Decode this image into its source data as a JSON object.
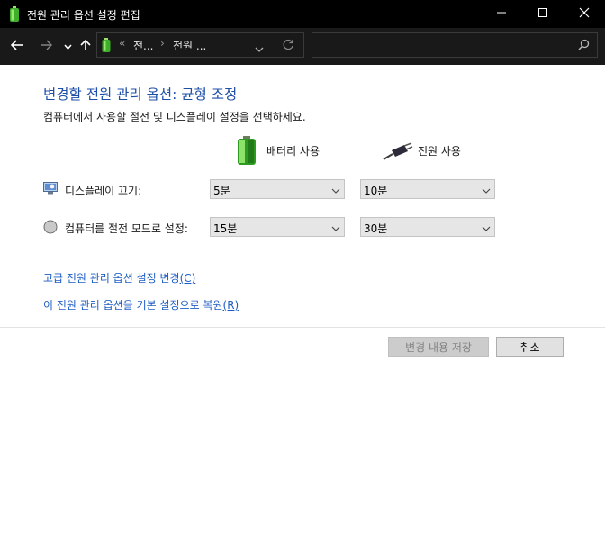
{
  "window": {
    "title": "전원 관리 옵션 설정 편집",
    "minimize_icon": "minimize-icon",
    "maximize_icon": "maximize-icon",
    "close_icon": "close-icon"
  },
  "nav": {
    "breadcrumb_overflow": "«",
    "breadcrumb": [
      "전...",
      "전원 ..."
    ],
    "search_placeholder": ""
  },
  "main": {
    "heading": "변경할 전원 관리 옵션: 균형 조정",
    "subtext": "컴퓨터에서 사용할 절전 및 디스플레이 설정을 선택하세요.",
    "columns": {
      "battery": "배터리 사용",
      "plugged": "전원 사용"
    },
    "settings": [
      {
        "label": "디스플레이 끄기:",
        "battery": "5분",
        "plugged": "10분",
        "icon": "display-icon"
      },
      {
        "label": "컴퓨터를 절전 모드로 설정:",
        "battery": "15분",
        "plugged": "30분",
        "icon": "sleep-icon"
      }
    ],
    "links": {
      "advanced": "고급 전원 관리 옵션 설정 변경",
      "advanced_accel": "(C)",
      "restore": "이 전원 관리 옵션을 기본 설정으로 복원",
      "restore_accel": "(R)"
    },
    "buttons": {
      "save": "변경 내용 저장",
      "cancel": "취소"
    }
  },
  "colors": {
    "heading": "#1e4fa8",
    "link": "#1e5dc4",
    "titlebar": "#000000",
    "navbar": "#191919"
  }
}
